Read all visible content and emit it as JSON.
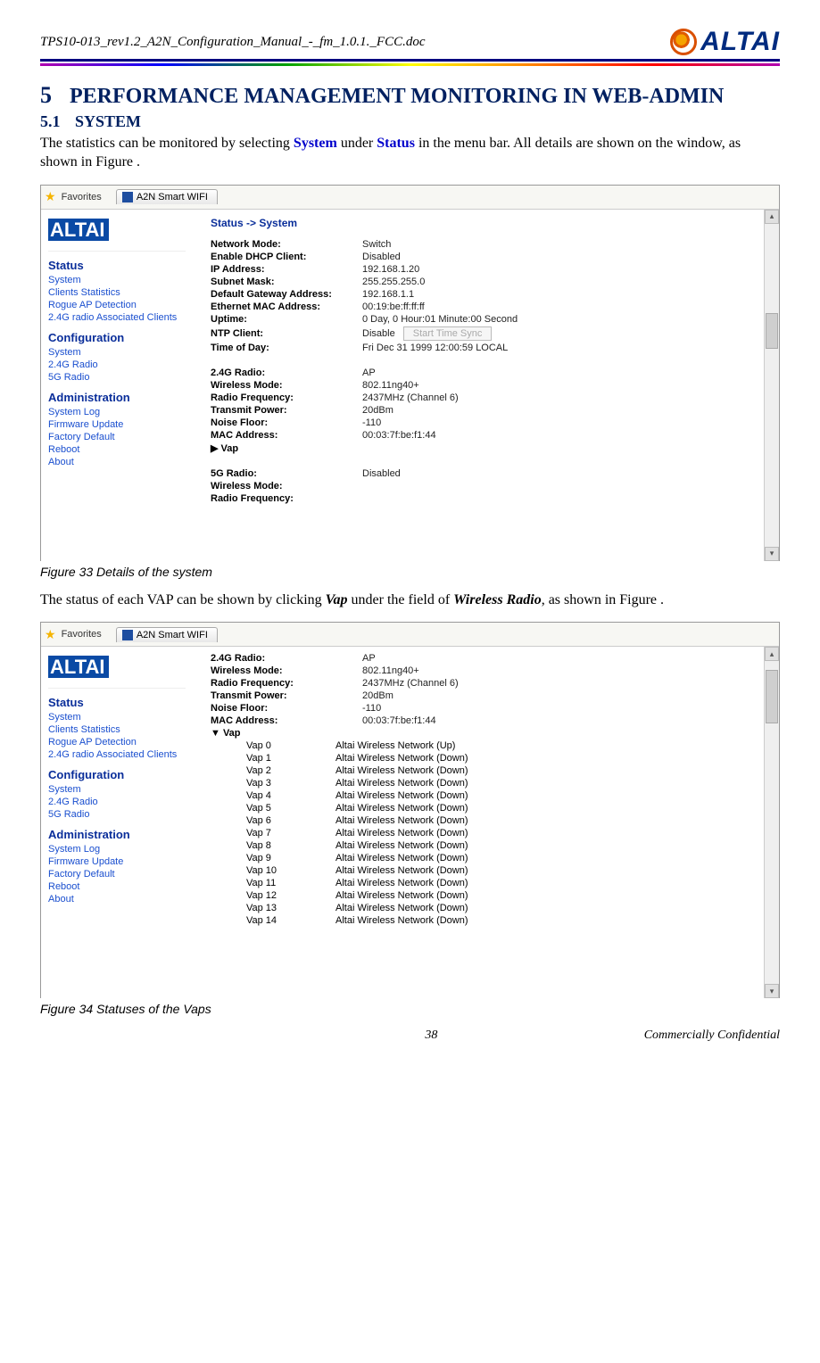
{
  "header": {
    "doc_title": "TPS10-013_rev1.2_A2N_Configuration_Manual_-_fm_1.0.1._FCC.doc",
    "logo_text": "ALTAI"
  },
  "h1": {
    "num": "5",
    "text": "PERFORMANCE MANAGEMENT MONITORING IN WEB-ADMIN"
  },
  "h2": {
    "num": "5.1",
    "text": "SYSTEM"
  },
  "para1": {
    "pre": "The statistics can be monitored by selecting ",
    "kw1": "System",
    "mid": " under ",
    "kw2": "Status",
    "post": " in the menu bar. All details are shown on the window, as shown in Figure ."
  },
  "para2": {
    "pre": "The status of each VAP can be shown by clicking ",
    "kw1": "Vap",
    "mid": " under the field of ",
    "kw2": "Wireless Radio",
    "post": ", as shown in Figure ."
  },
  "caption1": "Figure 33     Details of the system",
  "caption2": "Figure 34     Statuses of the Vaps",
  "footer": {
    "page": "38",
    "conf": "Commercially Confidential"
  },
  "common": {
    "favorites": "Favorites",
    "tab_title": "A2N Smart WIFI",
    "brand": "ALTAI",
    "nav": {
      "status_title": "Status",
      "status_items": [
        "System",
        "Clients Statistics",
        "Rogue AP Detection",
        "2.4G radio Associated Clients"
      ],
      "config_title": "Configuration",
      "config_items": [
        "System",
        "2.4G Radio",
        "5G Radio"
      ],
      "admin_title": "Administration",
      "admin_items": [
        "System Log",
        "Firmware Update",
        "Factory Default",
        "Reboot",
        "About"
      ]
    }
  },
  "shot1": {
    "breadcrumb_a": "Status ->",
    "breadcrumb_b": "System",
    "rows_net": [
      {
        "k": "Network Mode:",
        "v": "Switch"
      },
      {
        "k": "Enable DHCP Client:",
        "v": "Disabled"
      },
      {
        "k": "IP Address:",
        "v": "192.168.1.20"
      },
      {
        "k": "Subnet Mask:",
        "v": "255.255.255.0"
      },
      {
        "k": "Default Gateway Address:",
        "v": "192.168.1.1"
      },
      {
        "k": "Ethernet MAC Address:",
        "v": "00:19:be:ff:ff:ff"
      },
      {
        "k": "Uptime:",
        "v": "0 Day, 0 Hour:01 Minute:00 Second"
      }
    ],
    "ntp": {
      "k": "NTP Client:",
      "v": "Disable",
      "btn": "Start Time Sync"
    },
    "tod": {
      "k": "Time of Day:",
      "v": "Fri Dec 31 1999 12:00:59 LOCAL"
    },
    "rows_24": [
      {
        "k": "2.4G Radio:",
        "v": "AP"
      },
      {
        "k": "Wireless Mode:",
        "v": "802.11ng40+"
      },
      {
        "k": "Radio Frequency:",
        "v": "2437MHz (Channel 6)"
      },
      {
        "k": "Transmit Power:",
        "v": "20dBm"
      },
      {
        "k": "Noise Floor:",
        "v": "-110"
      },
      {
        "k": "MAC Address:",
        "v": "00:03:7f:be:f1:44"
      }
    ],
    "vap_label": "Vap",
    "rows_5g": [
      {
        "k": "5G Radio:",
        "v": "Disabled"
      },
      {
        "k": "Wireless Mode:",
        "v": ""
      },
      {
        "k": "Radio Frequency:",
        "v": ""
      }
    ]
  },
  "shot2": {
    "rows_24": [
      {
        "k": "2.4G Radio:",
        "v": "AP"
      },
      {
        "k": "Wireless Mode:",
        "v": "802.11ng40+"
      },
      {
        "k": "Radio Frequency:",
        "v": "2437MHz (Channel 6)"
      },
      {
        "k": "Transmit Power:",
        "v": "20dBm"
      },
      {
        "k": "Noise Floor:",
        "v": "-110"
      },
      {
        "k": "MAC Address:",
        "v": "00:03:7f:be:f1:44"
      }
    ],
    "vap_label": "Vap",
    "vaps": [
      {
        "n": "Vap 0",
        "s": "Altai Wireless Network (Up)"
      },
      {
        "n": "Vap 1",
        "s": "Altai Wireless Network (Down)"
      },
      {
        "n": "Vap 2",
        "s": "Altai Wireless Network (Down)"
      },
      {
        "n": "Vap 3",
        "s": "Altai Wireless Network (Down)"
      },
      {
        "n": "Vap 4",
        "s": "Altai Wireless Network (Down)"
      },
      {
        "n": "Vap 5",
        "s": "Altai Wireless Network (Down)"
      },
      {
        "n": "Vap 6",
        "s": "Altai Wireless Network (Down)"
      },
      {
        "n": "Vap 7",
        "s": "Altai Wireless Network (Down)"
      },
      {
        "n": "Vap 8",
        "s": "Altai Wireless Network (Down)"
      },
      {
        "n": "Vap 9",
        "s": "Altai Wireless Network (Down)"
      },
      {
        "n": "Vap 10",
        "s": "Altai Wireless Network (Down)"
      },
      {
        "n": "Vap 11",
        "s": "Altai Wireless Network (Down)"
      },
      {
        "n": "Vap 12",
        "s": "Altai Wireless Network (Down)"
      },
      {
        "n": "Vap 13",
        "s": "Altai Wireless Network (Down)"
      },
      {
        "n": "Vap 14",
        "s": "Altai Wireless Network (Down)"
      }
    ]
  }
}
